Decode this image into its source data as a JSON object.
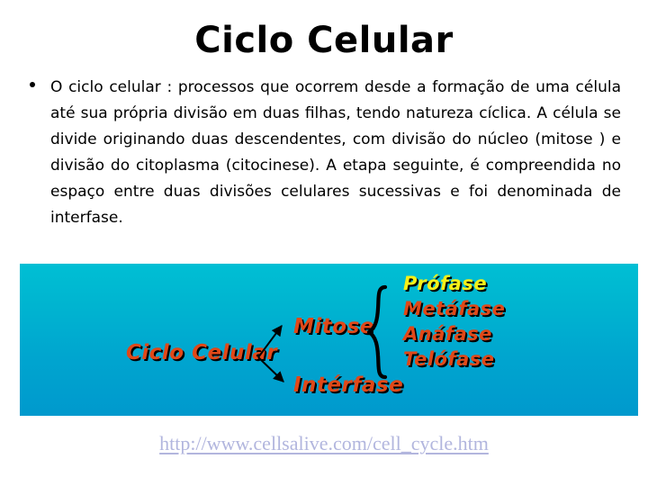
{
  "slide": {
    "title": "Ciclo Celular",
    "background_color": "#ffffff",
    "body": {
      "bullet_glyph": "•",
      "text": "O ciclo celular : processos que ocorrem desde a formação de uma célula até sua própria divisão em duas filhas, tendo natureza cíclica. A célula se divide originando duas descendentes, com divisão do núcleo (mitose ) e  divisão do citoplasma (citocinese). A etapa seguinte, é compreendida no espaço entre duas divisões celulares sucessivas e foi denominada de interfase."
    },
    "diagram": {
      "background_gradient_from": "#00bfd4",
      "background_gradient_to": "#0099cd",
      "root_label": "Ciclo Celular",
      "branch_mitose": "Mitose",
      "branch_interfase": "Intérfase",
      "accent_color": "#e04818",
      "highlight_color": "#f6f018",
      "phases": [
        {
          "label": "Prófase",
          "color": "#f6f018"
        },
        {
          "label": "Metáfase",
          "color": "#e04818"
        },
        {
          "label": "Anáfase",
          "color": "#e04818"
        },
        {
          "label": "Telófase",
          "color": "#e04818"
        }
      ]
    },
    "source_url": "http://www.cellsalive.com/cell_cycle.htm",
    "source_url_color": "#b2b6de"
  }
}
